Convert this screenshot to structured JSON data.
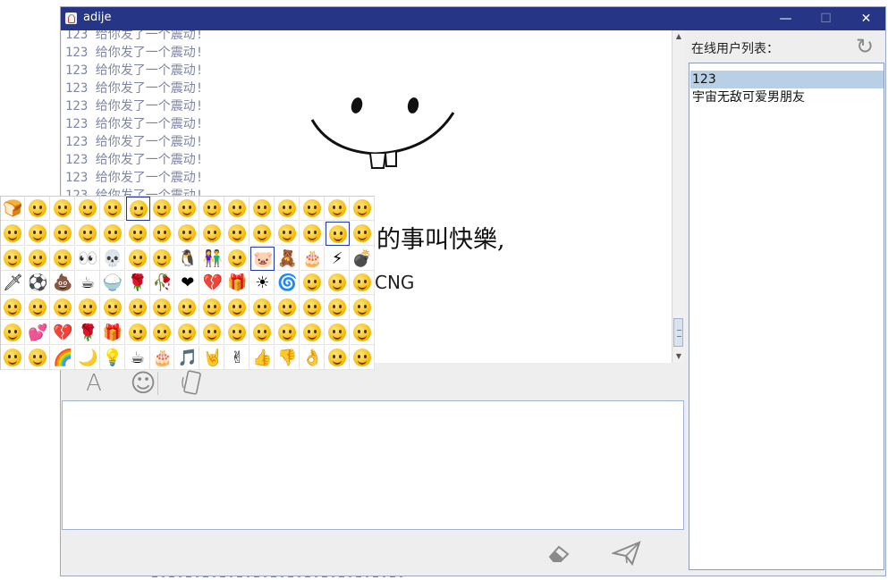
{
  "window": {
    "title": "adije"
  },
  "titlebar_controls": {
    "minimize": "—",
    "maximize": "☐",
    "close": "✕"
  },
  "chat": {
    "messages": [
      "123 给你发了一个震动!",
      "123 给你发了一个震动!",
      "123 给你发了一个震动!",
      "123 给你发了一个震动!",
      "123 给你发了一个震动!",
      "123 给你发了一个震动!",
      "123 给你发了一个震动!",
      "123 给你发了一个震动!",
      "123 给你发了一个震动!",
      "123 给你发了一个震动!"
    ],
    "image_text_line1": "的事叫快樂,",
    "image_text_line2": "CNG"
  },
  "toolbar": {
    "font_icon": "font-icon",
    "emoji_icon": "emoji-icon",
    "shake_icon": "phone-shake-icon"
  },
  "bottom": {
    "clear_icon": "eraser-icon",
    "send_icon": "send-plane-icon"
  },
  "users_panel": {
    "label": "在线用户列表：",
    "refresh_icon": "refresh-icon",
    "users": [
      "123",
      "宇宙无敌可爱男朋友"
    ],
    "selected_index": 0
  },
  "emoji_panel": {
    "rows": 7,
    "cols": 15,
    "highlighted": [
      [
        0,
        5
      ],
      [
        1,
        13
      ],
      [
        2,
        10
      ]
    ]
  },
  "colors": {
    "titlebar": "#263585",
    "message_text": "#7d86a4",
    "selection": "#b8cfe5",
    "emoji_highlight": "#2333a8"
  }
}
